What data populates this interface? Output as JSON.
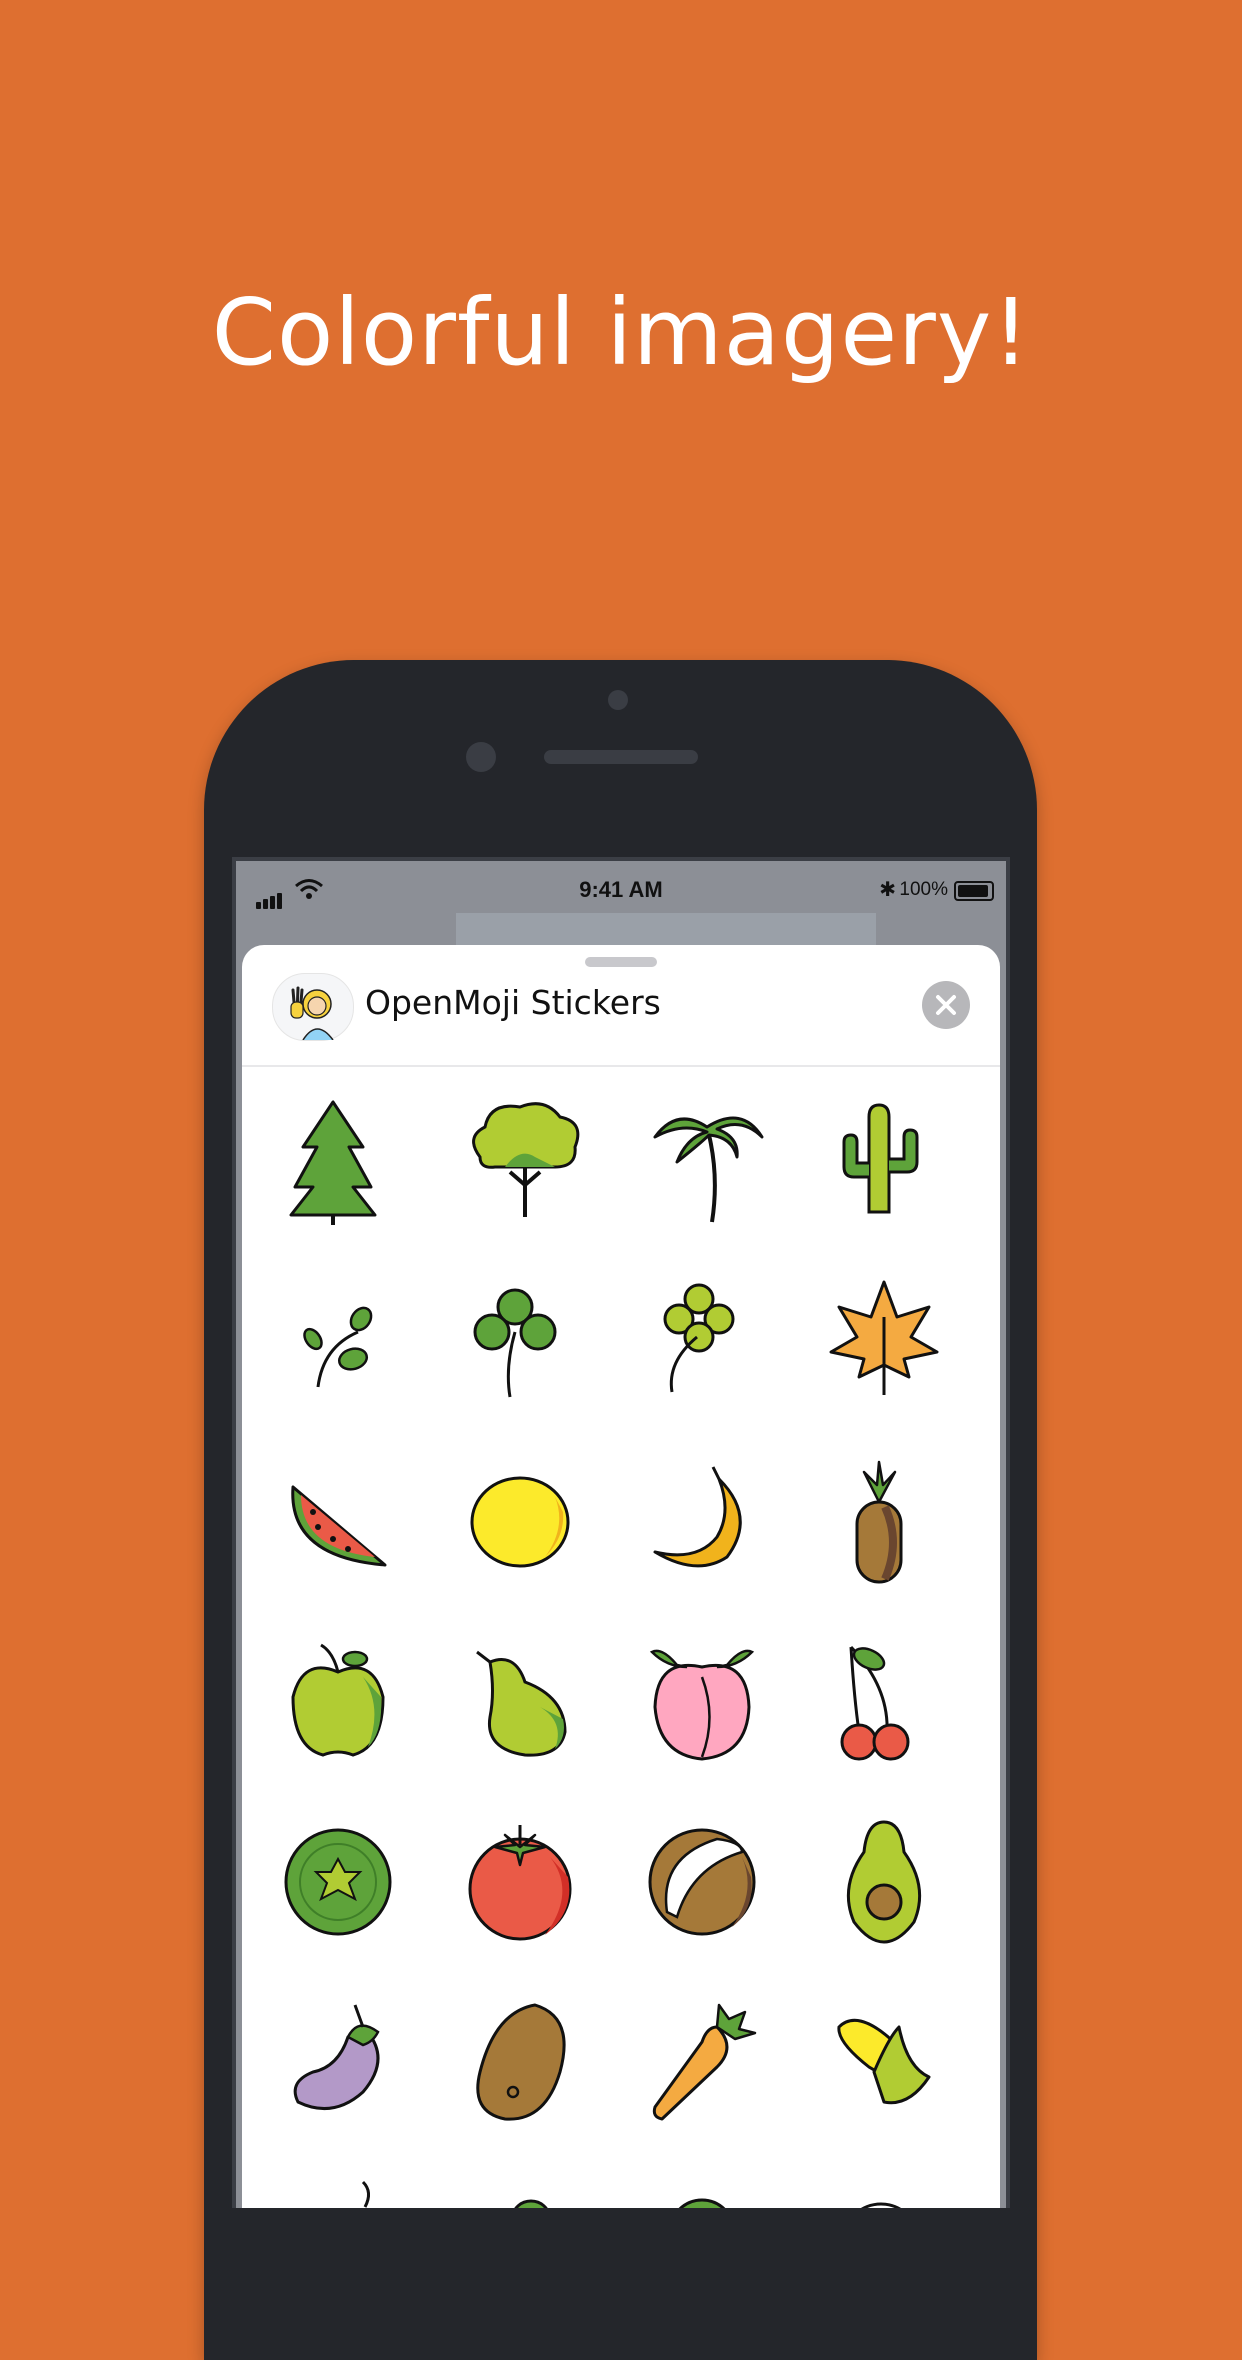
{
  "headline": "Colorful imagery!",
  "status_bar": {
    "time": "9:41 AM",
    "battery": "100%"
  },
  "sticker_sheet": {
    "title": "OpenMoji Stickers",
    "stickers": [
      "evergreen-tree-icon",
      "deciduous-tree-icon",
      "palm-tree-icon",
      "cactus-icon",
      "herb-icon",
      "shamrock-icon",
      "four-leaf-clover-icon",
      "maple-leaf-icon",
      "watermelon-icon",
      "lemon-icon",
      "banana-icon",
      "pineapple-icon",
      "green-apple-icon",
      "pear-icon",
      "peach-icon",
      "cherries-icon",
      "kiwi-icon",
      "tomato-icon",
      "coconut-icon",
      "avocado-icon",
      "eggplant-icon",
      "potato-icon",
      "carrot-icon",
      "corn-icon"
    ]
  },
  "colors": {
    "background": "#DE6F30",
    "phone_body": "#24262B"
  }
}
